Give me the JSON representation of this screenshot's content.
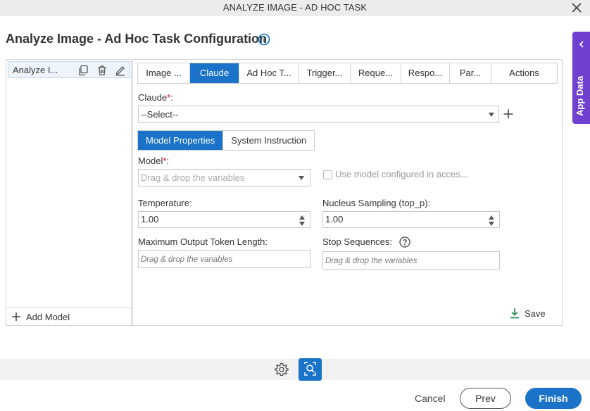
{
  "window": {
    "title": "ANALYZE IMAGE - AD HOC TASK"
  },
  "page": {
    "title": "Analyze Image - Ad Hoc Task Configuration"
  },
  "left_panel": {
    "model_item_label": "Analyze I...",
    "add_model_label": "Add Model"
  },
  "tabs": [
    {
      "label": "Image ...",
      "active": false
    },
    {
      "label": "Claude",
      "active": true
    },
    {
      "label": "Ad Hoc T...",
      "active": false
    },
    {
      "label": "Trigger...",
      "active": false
    },
    {
      "label": "Reque...",
      "active": false
    },
    {
      "label": "Respo...",
      "active": false
    },
    {
      "label": "Par...",
      "active": false
    },
    {
      "label": "Actions",
      "active": false
    }
  ],
  "claude": {
    "label": "Claude",
    "required_mark": "*",
    "label_suffix": ":",
    "select_value": "--Select--"
  },
  "subtabs": [
    {
      "label": "Model Properties",
      "active": true
    },
    {
      "label": "System Instruction",
      "active": false
    }
  ],
  "model": {
    "label": "Model",
    "required_mark": "*",
    "label_suffix": ":",
    "placeholder": "Drag & drop the variables",
    "checkbox_label": "Use model configured in acces...",
    "checkbox_checked": false
  },
  "temperature": {
    "label": "Temperature:",
    "value": "1.00"
  },
  "nucleus": {
    "label": "Nucleus Sampling (top_p):",
    "value": "1.00"
  },
  "max_tokens": {
    "label": "Maximum Output Token Length:",
    "placeholder": "Drag & drop the variables"
  },
  "stop_sequences": {
    "label": "Stop Sequences:",
    "placeholder": "Drag & drop the variables"
  },
  "save_label": "Save",
  "app_data_label": "App Data",
  "footer": {
    "cancel": "Cancel",
    "prev": "Prev",
    "finish": "Finish"
  },
  "colors": {
    "primary": "#1a73c8",
    "app_data": "#6f3fcf",
    "required": "#d0021b"
  },
  "icons": [
    "close-icon",
    "info-icon",
    "copy-icon",
    "delete-icon",
    "edit-icon",
    "plus-icon",
    "chevron-down-icon",
    "help-icon",
    "download-icon",
    "chevron-left-icon",
    "gear-icon",
    "image-search-icon"
  ]
}
